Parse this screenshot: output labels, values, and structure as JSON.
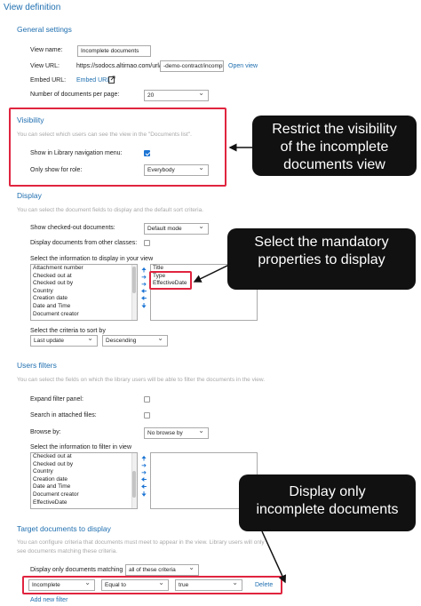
{
  "page_title": "View definition",
  "general": {
    "heading": "General settings",
    "view_name_label": "View name:",
    "view_name_value": "Incomplete documents",
    "view_url_label": "View URL:",
    "view_url_prefix": "https://sodocs.altirnao.com/url/",
    "view_url_value": "-demo-contract/incomplet",
    "open_view_link": "Open view",
    "embed_url_label": "Embed URL:",
    "embed_url_link": "Embed URL",
    "docs_per_page_label": "Number of documents per page:",
    "docs_per_page_value": "20"
  },
  "visibility": {
    "heading": "Visibility",
    "description": "You can select which users can see the view in the \"Documents list\".",
    "show_nav_label": "Show in Library navigation menu:",
    "show_nav_checked": true,
    "role_label": "Only show for role:",
    "role_value": "Everybody"
  },
  "display": {
    "heading": "Display",
    "description": "You can select the document fields to display and the default sort criteria.",
    "checked_out_label": "Show checked-out documents:",
    "checked_out_value": "Default mode",
    "other_classes_label": "Display documents from other classes:",
    "info_label": "Select the information to display in your view",
    "available_items": [
      "Attachment number",
      "Checked out at",
      "Checked out by",
      "Country",
      "Creation date",
      "Date and Time",
      "Document creator"
    ],
    "selected_items": [
      "Title",
      "Type",
      "EffectiveDate"
    ],
    "sort_label": "Select the criteria to sort by",
    "sort_field": "Last update",
    "sort_order": "Descending"
  },
  "users_filters": {
    "heading": "Users filters",
    "description": "You can select the fields on which the library users will be able to filter the documents in the view.",
    "expand_label": "Expand filter panel:",
    "search_attached_label": "Search in attached files:",
    "browse_label": "Browse by:",
    "browse_value": "No browse by",
    "info_label": "Select the information to filter in view",
    "available_items": [
      "Checked out at",
      "Checked out by",
      "Country",
      "Creation date",
      "Date and Time",
      "Document creator",
      "EffectiveDate"
    ]
  },
  "target": {
    "heading": "Target documents to display",
    "description_line1": "You can configure criteria that documents must meet to appear in the view. Library users will only",
    "description_line2": "see documents matching these criteria.",
    "matching_label": "Display only documents matching",
    "matching_value": "all of these criteria",
    "criteria_field": "Incomplete",
    "criteria_operator": "Equal to",
    "criteria_value": "true",
    "delete_link": "Delete",
    "add_filter_link": "Add new filter"
  },
  "callouts": {
    "visibility": [
      "Restrict the visibility",
      "of the incomplete",
      "documents view"
    ],
    "mandatory": [
      "Select the mandatory",
      "properties to display"
    ],
    "display_only": [
      "Display only",
      "incomplete documents"
    ]
  },
  "colors": {
    "heading_blue": "#1f6fb0",
    "highlight_red": "#e0243f",
    "callout_bg": "#111111",
    "checkbox_blue": "#1b74d4"
  }
}
